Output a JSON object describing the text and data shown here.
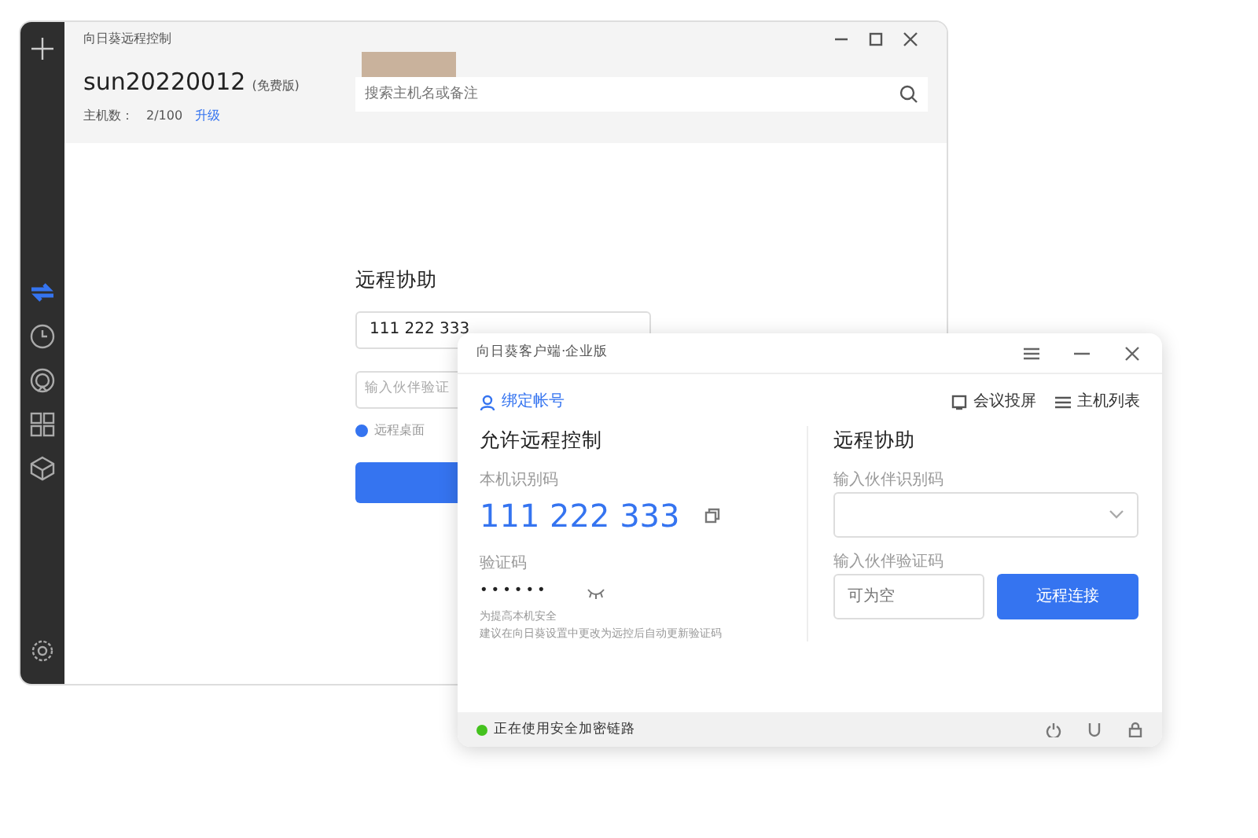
{
  "main_window": {
    "title": "向日葵远程控制",
    "account": {
      "name": "sun20220012",
      "edition": "(免费版)",
      "host_count_label": "主机数：",
      "host_count": "2/100",
      "upgrade": "升级"
    },
    "search": {
      "placeholder": "搜索主机名或备注"
    },
    "sidebar": {
      "items": [
        {
          "kind": "swap",
          "selected": true
        },
        {
          "kind": "clock",
          "selected": false
        },
        {
          "kind": "ring",
          "selected": false
        },
        {
          "kind": "grid",
          "selected": false
        },
        {
          "kind": "cube",
          "selected": false
        }
      ]
    },
    "assist": {
      "heading": "远程协助",
      "partner_id": "111 222 333",
      "code_placeholder": "输入伙伴验证",
      "mode": {
        "label": "远程桌面",
        "selected": true
      }
    }
  },
  "client_window": {
    "title": "向日葵客户端·企业版",
    "bind_account": "绑定帐号",
    "toolbar": [
      "会议投屏",
      "主机列表"
    ],
    "allow": {
      "heading": "允许远程控制",
      "id_label": "本机识别码",
      "id": "111 222 333",
      "code_label": "验证码",
      "code": "••••••",
      "hint": [
        "为提高本机安全",
        "建议在向日葵设置中更改为远控后自动更新验证码"
      ]
    },
    "assist": {
      "heading": "远程协助",
      "id_label": "输入伙伴识别码",
      "code_label": "输入伙伴验证码",
      "code_placeholder": "可为空",
      "connect": "远程连接"
    },
    "status": {
      "text": "正在使用安全加密链路",
      "secure": true
    }
  }
}
